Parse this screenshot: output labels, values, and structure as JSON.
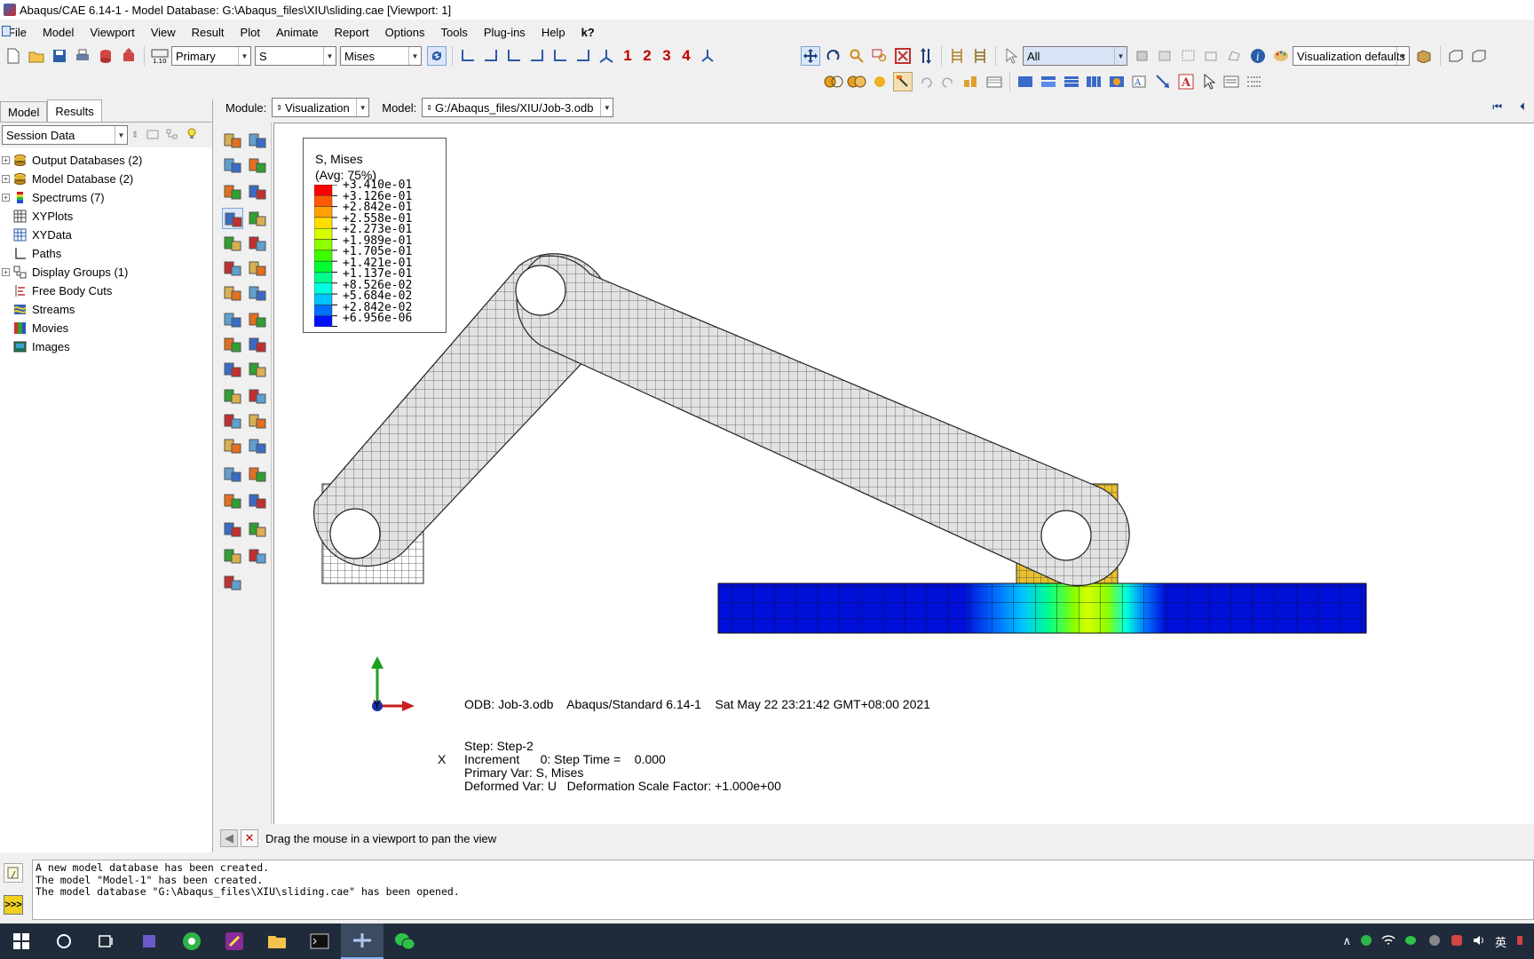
{
  "window": {
    "title": "Abaqus/CAE 6.14-1 - Model Database: G:\\Abaqus_files\\XIU\\sliding.cae [Viewport: 1]"
  },
  "menu": {
    "items": [
      "File",
      "Model",
      "Viewport",
      "View",
      "Result",
      "Plot",
      "Animate",
      "Report",
      "Options",
      "Tools",
      "Plug-ins",
      "Help"
    ],
    "help_query": "k?"
  },
  "toolbar": {
    "field_output_selector": "Primary",
    "variable_selector": "S",
    "invariant_selector": "Mises",
    "viewport_numbers": [
      "1",
      "2",
      "3",
      "4"
    ],
    "selection_filter": "All",
    "visualization_defaults": "Visualization defaults"
  },
  "tabs": {
    "model": "Model",
    "results": "Results"
  },
  "session": {
    "selector": "Session Data"
  },
  "tree": {
    "items": [
      {
        "label": "Output Databases (2)",
        "expandable": true,
        "icon": "database-stack-icon"
      },
      {
        "label": "Model Database (2)",
        "expandable": true,
        "icon": "database-stack-icon"
      },
      {
        "label": "Spectrums (7)",
        "expandable": true,
        "icon": "spectrum-icon"
      },
      {
        "label": "XYPlots",
        "expandable": false,
        "icon": "xyplot-grid-icon"
      },
      {
        "label": "XYData",
        "expandable": false,
        "icon": "xydata-grid-icon"
      },
      {
        "label": "Paths",
        "expandable": false,
        "icon": "path-icon"
      },
      {
        "label": "Display Groups (1)",
        "expandable": true,
        "icon": "display-group-icon"
      },
      {
        "label": "Free Body Cuts",
        "expandable": false,
        "icon": "free-body-cut-icon"
      },
      {
        "label": "Streams",
        "expandable": false,
        "icon": "stream-icon"
      },
      {
        "label": "Movies",
        "expandable": false,
        "icon": "movie-icon"
      },
      {
        "label": "Images",
        "expandable": false,
        "icon": "image-icon"
      }
    ]
  },
  "module_bar": {
    "module_label": "Module:",
    "module_value": "Visualization",
    "model_label": "Model:",
    "model_value": "G:/Abaqus_files/XIU/Job-3.odb"
  },
  "legend": {
    "title1": "S, Mises",
    "title2": "(Avg: 75%)",
    "values": [
      "+3.410e-01",
      "+3.126e-01",
      "+2.842e-01",
      "+2.558e-01",
      "+2.273e-01",
      "+1.989e-01",
      "+1.705e-01",
      "+1.421e-01",
      "+1.137e-01",
      "+8.526e-02",
      "+5.684e-02",
      "+2.842e-02",
      "+6.956e-06"
    ],
    "colors": [
      "#ff0000",
      "#ff5a00",
      "#ffa200",
      "#ffde00",
      "#d6ff00",
      "#8cff00",
      "#3cff00",
      "#00ff30",
      "#00ff8e",
      "#00ffe0",
      "#00c4ff",
      "#0070ff",
      "#0010ff"
    ]
  },
  "triad": {
    "y": "Y",
    "x": "X"
  },
  "info": {
    "odb_line": "ODB: Job-3.odb    Abaqus/Standard 6.14-1    Sat May 22 23:21:42 GMT+08:00 2021",
    "step": "Step: Step-2",
    "increment": "Increment      0: Step Time =    0.000",
    "primary_var": "Primary Var: S, Mises",
    "deformed_var": "Deformed Var: U   Deformation Scale Factor: +1.000e+00"
  },
  "prompt": {
    "text": "Drag the mouse in a viewport to pan the view"
  },
  "messages": [
    "A new model database has been created.",
    "The model \"Model-1\" has been created.",
    "The model database \"G:\\Abaqus_files\\XIU\\sliding.cae\" has been opened."
  ],
  "taskbar": {
    "ime_indicator": "英"
  }
}
